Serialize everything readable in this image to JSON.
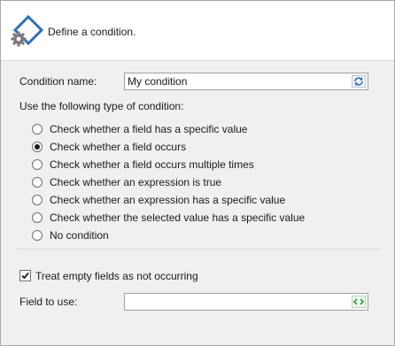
{
  "header": {
    "icon": "diamond-gear-icon",
    "text": "Define a condition."
  },
  "condition_name": {
    "label": "Condition name:",
    "value": "My condition",
    "button_icon": "refresh-icon"
  },
  "type_section": {
    "label": "Use the following type of condition:",
    "options": [
      {
        "label": "Check whether a field has a specific value",
        "checked": false
      },
      {
        "label": "Check whether a field occurs",
        "checked": true
      },
      {
        "label": "Check whether a field occurs multiple times",
        "checked": false
      },
      {
        "label": "Check whether an expression is true",
        "checked": false
      },
      {
        "label": "Check whether an expression has a specific value",
        "checked": false
      },
      {
        "label": "Check whether the selected value has a specific value",
        "checked": false
      },
      {
        "label": "No condition",
        "checked": false
      }
    ]
  },
  "treat_empty": {
    "label": "Treat empty fields as not occurring",
    "checked": true
  },
  "field_to_use": {
    "label": "Field to use:",
    "value": "",
    "button_icon": "field-picker-icon"
  }
}
